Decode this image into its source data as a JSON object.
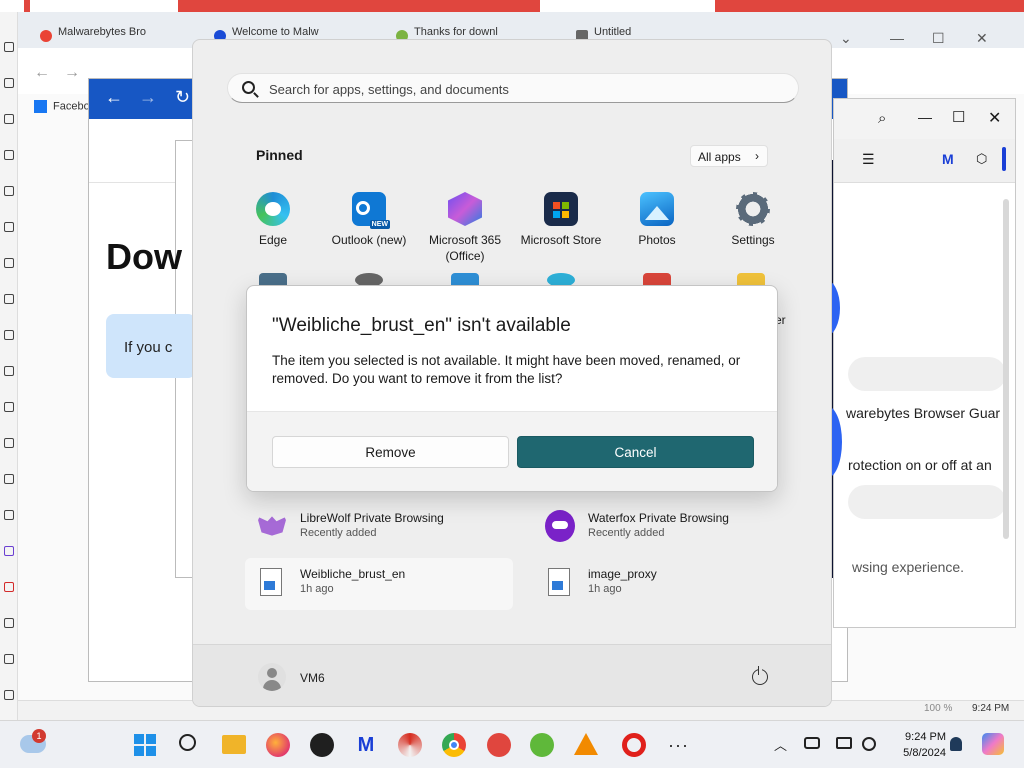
{
  "background": {
    "vivaldi_tabs": [
      "Malwarebytes Bro",
      "Welcome to Malw",
      "Thanks for downl",
      "Untitled"
    ],
    "bookmark": "Facebo",
    "page_heading": "Dow",
    "page_box_text": "If you c",
    "malwarebytes_text_1": "warebytes Browser Guar",
    "malwarebytes_text_2": "rotection on or off at an",
    "malwarebytes_text_3": "wsing experience.",
    "status_zoom": "100 %",
    "status_time": "9:24 PM"
  },
  "start_menu": {
    "search_placeholder": "Search for apps, settings, and documents",
    "pinned_title": "Pinned",
    "all_apps_label": "All apps",
    "apps": [
      {
        "label": "Edge",
        "icon": "edge-icon"
      },
      {
        "label": "Outlook (new)",
        "icon": "outlook-icon"
      },
      {
        "label": "Microsoft 365 (Office)",
        "icon": "m365-icon"
      },
      {
        "label": "Microsoft Store",
        "icon": "store-icon"
      },
      {
        "label": "Photos",
        "icon": "photos-icon"
      },
      {
        "label": "Settings",
        "icon": "settings-icon"
      }
    ],
    "partial_row_label": "er",
    "recommended": [
      {
        "name": "LibreWolf Private Browsing",
        "sub": "Recently added"
      },
      {
        "name": "Waterfox Private Browsing",
        "sub": "Recently added"
      },
      {
        "name": "Weibliche_brust_en",
        "sub": "1h ago"
      },
      {
        "name": "image_proxy",
        "sub": "1h ago"
      }
    ],
    "user_name": "VM6"
  },
  "dialog": {
    "title": "\"Weibliche_brust_en\" isn't available",
    "message": "The item you selected is not available. It might have been moved, renamed, or removed. Do you want to remove it from the list?",
    "remove_label": "Remove",
    "cancel_label": "Cancel"
  },
  "taskbar": {
    "notification_count": "1",
    "time": "9:24 PM",
    "date": "5/8/2024",
    "apps": [
      "start-icon",
      "search-icon",
      "file-explorer-icon",
      "firefox-icon",
      "obs-icon",
      "malwarebytes-icon",
      "ccleaner-icon",
      "chrome-icon",
      "app-icon",
      "greenshot-icon",
      "vlc-icon",
      "opera-icon",
      "more-icon"
    ]
  },
  "colors": {
    "cancel_button": "#1f6770",
    "edge_bar": "#1757c4",
    "vivaldi_red": "#e0463e"
  }
}
